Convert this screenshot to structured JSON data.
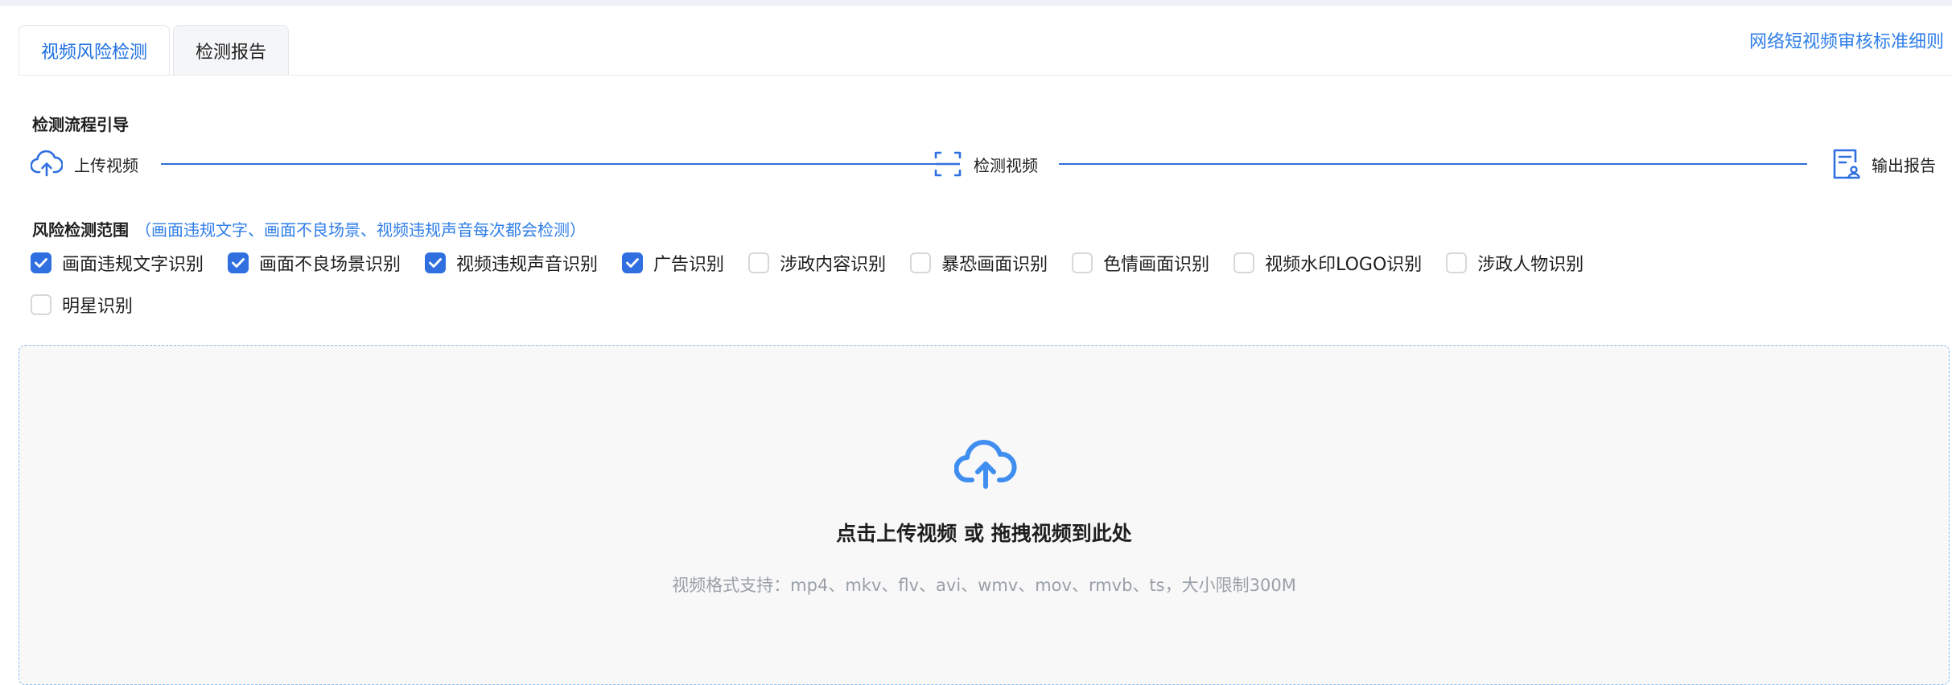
{
  "tabs": [
    {
      "label": "视频风险检测",
      "active": true
    },
    {
      "label": "检测报告",
      "active": false
    }
  ],
  "rules_link": "网络短视频审核标准细则",
  "flow": {
    "title": "检测流程引导",
    "steps": [
      {
        "label": "上传视频",
        "icon": "cloud-upload-icon"
      },
      {
        "label": "检测视频",
        "icon": "scan-icon"
      },
      {
        "label": "输出报告",
        "icon": "report-icon"
      }
    ]
  },
  "scope": {
    "title": "风险检测范围",
    "note": "（画面违规文字、画面不良场景、视频违规声音每次都会检测）",
    "options": [
      {
        "label": "画面违规文字识别",
        "checked": true
      },
      {
        "label": "画面不良场景识别",
        "checked": true
      },
      {
        "label": "视频违规声音识别",
        "checked": true
      },
      {
        "label": "广告识别",
        "checked": true
      },
      {
        "label": "涉政内容识别",
        "checked": false
      },
      {
        "label": "暴恐画面识别",
        "checked": false
      },
      {
        "label": "色情画面识别",
        "checked": false
      },
      {
        "label": "视频水印LOGO识别",
        "checked": false
      },
      {
        "label": "涉政人物识别",
        "checked": false
      },
      {
        "label": "明星识别",
        "checked": false
      }
    ]
  },
  "upload": {
    "icon": "cloud-upload-icon",
    "main_text": "点击上传视频 或 拖拽视频到此处",
    "hint": "视频格式支持：mp4、mkv、flv、avi、wmv、mov、rmvb、ts，大小限制300M"
  },
  "colors": {
    "accent": "#2f6fe0",
    "link": "#2f7ee8",
    "upload_icon": "#3f8ef0"
  }
}
